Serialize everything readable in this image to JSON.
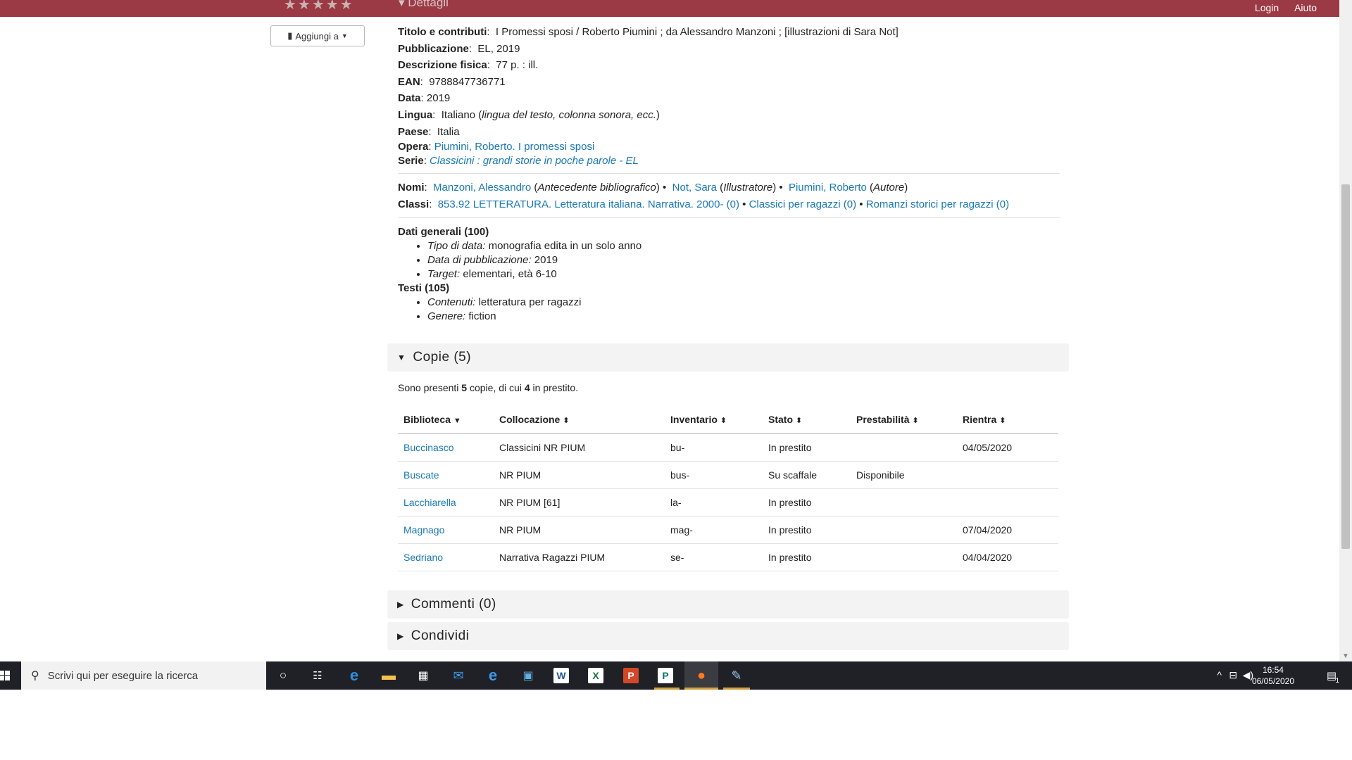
{
  "topbar": {
    "stars": "★★★★★",
    "section_title": "▾ Dettagli",
    "login": "Login",
    "help": "Aiuto"
  },
  "aggiungi": {
    "label": "Aggiungi a",
    "icon": "book-icon"
  },
  "details": [
    {
      "label": "Titolo e contributi",
      "value": "I Promessi sposi / Roberto Piumini ; da Alessandro Manzoni ; [illustrazioni di Sara Not]"
    },
    {
      "label": "Pubblicazione",
      "value": "EL, 2019"
    },
    {
      "label": "Descrizione fisica",
      "value": "77 p. : ill."
    },
    {
      "label": "EAN",
      "value": "9788847736771"
    },
    {
      "label": "Data",
      "value": "2019"
    },
    {
      "label": "Lingua",
      "value": "Italiano",
      "note": "lingua del testo, colonna sonora, ecc."
    },
    {
      "label": "Paese",
      "value": "Italia"
    },
    {
      "label": "Opera",
      "value": "Piumini, Roberto. I promessi sposi"
    },
    {
      "label": "Serie",
      "value": "Classicini : grandi storie in poche parole - EL"
    }
  ],
  "nomi": {
    "label": "Nomi",
    "items": [
      {
        "name": "Manzoni, Alessandro",
        "role": "Antecedente bibliografico"
      },
      {
        "name": "Not, Sara",
        "role": "Illustratore"
      },
      {
        "name": "Piumini, Roberto",
        "role": "Autore"
      }
    ]
  },
  "classi": {
    "label": "Classi",
    "items": [
      "853.92 LETTERATURA. Letteratura italiana. Narrativa. 2000- (0)",
      "Classici per ragazzi (0)",
      "Romanzi storici per ragazzi (0)"
    ]
  },
  "general": [
    {
      "heading": "Dati generali (100)",
      "items": [
        {
          "k": "Tipo di data:",
          "v": "monografia edita in un solo anno"
        },
        {
          "k": "Data di pubblicazione:",
          "v": "2019"
        },
        {
          "k": "Target:",
          "v": "elementari, età 6-10"
        }
      ]
    },
    {
      "heading": "Testi (105)",
      "items": [
        {
          "k": "Contenuti:",
          "v": "letteratura per ragazzi"
        },
        {
          "k": "Genere:",
          "v": "fiction"
        }
      ]
    }
  ],
  "copies": {
    "panel_title": "Copie (5)",
    "intro": {
      "a": "Sono presenti ",
      "count": "5",
      "b": " copie, di cui ",
      "loaned": "4",
      "c": " in prestito."
    },
    "columns": [
      "Biblioteca",
      "Collocazione",
      "Inventario",
      "Stato",
      "Prestabilità",
      "Rientra"
    ],
    "rows": [
      [
        "Buccinasco",
        "Classicini NR PIUM",
        "bu-",
        "In prestito",
        "",
        "04/05/2020"
      ],
      [
        "Buscate",
        "NR PIUM",
        "bus-",
        "Su scaffale",
        "Disponibile",
        ""
      ],
      [
        "Lacchiarella",
        "NR PIUM [61]",
        "la-",
        "In prestito",
        "",
        ""
      ],
      [
        "Magnago",
        "NR PIUM",
        "mag-",
        "In prestito",
        "",
        "07/04/2020"
      ],
      [
        "Sedriano",
        "Narrativa Ragazzi PIUM",
        "se-",
        "In prestito",
        "",
        "04/04/2020"
      ]
    ]
  },
  "panels": {
    "comments": "Commenti (0)",
    "share": "Condividi"
  },
  "taskbar": {
    "search_placeholder": "Scrivi qui per eseguire la ricerca",
    "time": "16:54",
    "date": "06/05/2020",
    "notifications": "1"
  },
  "colors": {
    "topbar": "#9b3a44",
    "link": "#1a78b6",
    "panel": "#f3f3f3",
    "taskbar": "#1f2127"
  }
}
